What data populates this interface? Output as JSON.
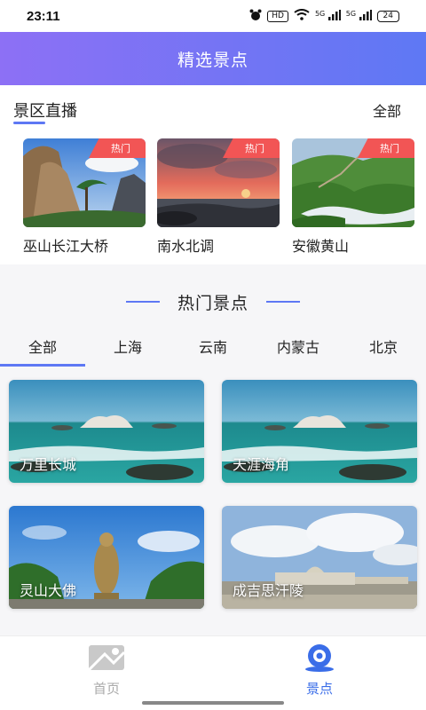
{
  "status_bar": {
    "time": "23:11",
    "icons": [
      "alarm-icon",
      "hd-icon",
      "wifi-icon",
      "signal-5g-icon",
      "signal-5g-icon",
      "battery-icon"
    ],
    "hd_label": "HD",
    "net1": "5G",
    "net2": "5G",
    "battery": "24"
  },
  "header": {
    "title": "精选景点"
  },
  "live_section": {
    "title": "景区直播",
    "all_label": "全部",
    "badge_label": "热门",
    "items": [
      {
        "name": "巫山长江大桥"
      },
      {
        "name": "南水北调"
      },
      {
        "name": "安徽黄山"
      }
    ]
  },
  "hot_section": {
    "title": "热门景点",
    "tabs": [
      "全部",
      "上海",
      "云南",
      "内蒙古",
      "北京"
    ],
    "selected_tab": "全部",
    "cards": [
      {
        "name": "万里长城"
      },
      {
        "name": "天涯海角"
      },
      {
        "name": "灵山大佛"
      },
      {
        "name": "成吉思汗陵"
      }
    ]
  },
  "bottom_nav": {
    "items": [
      {
        "label": "首页",
        "icon": "home-map-icon",
        "active": false
      },
      {
        "label": "景点",
        "icon": "camera-icon",
        "active": true
      }
    ]
  },
  "colors": {
    "accent": "#5e78f4",
    "header_start": "#8d70f5",
    "badge": "#f25555",
    "inactive": "#aaaaaa"
  }
}
